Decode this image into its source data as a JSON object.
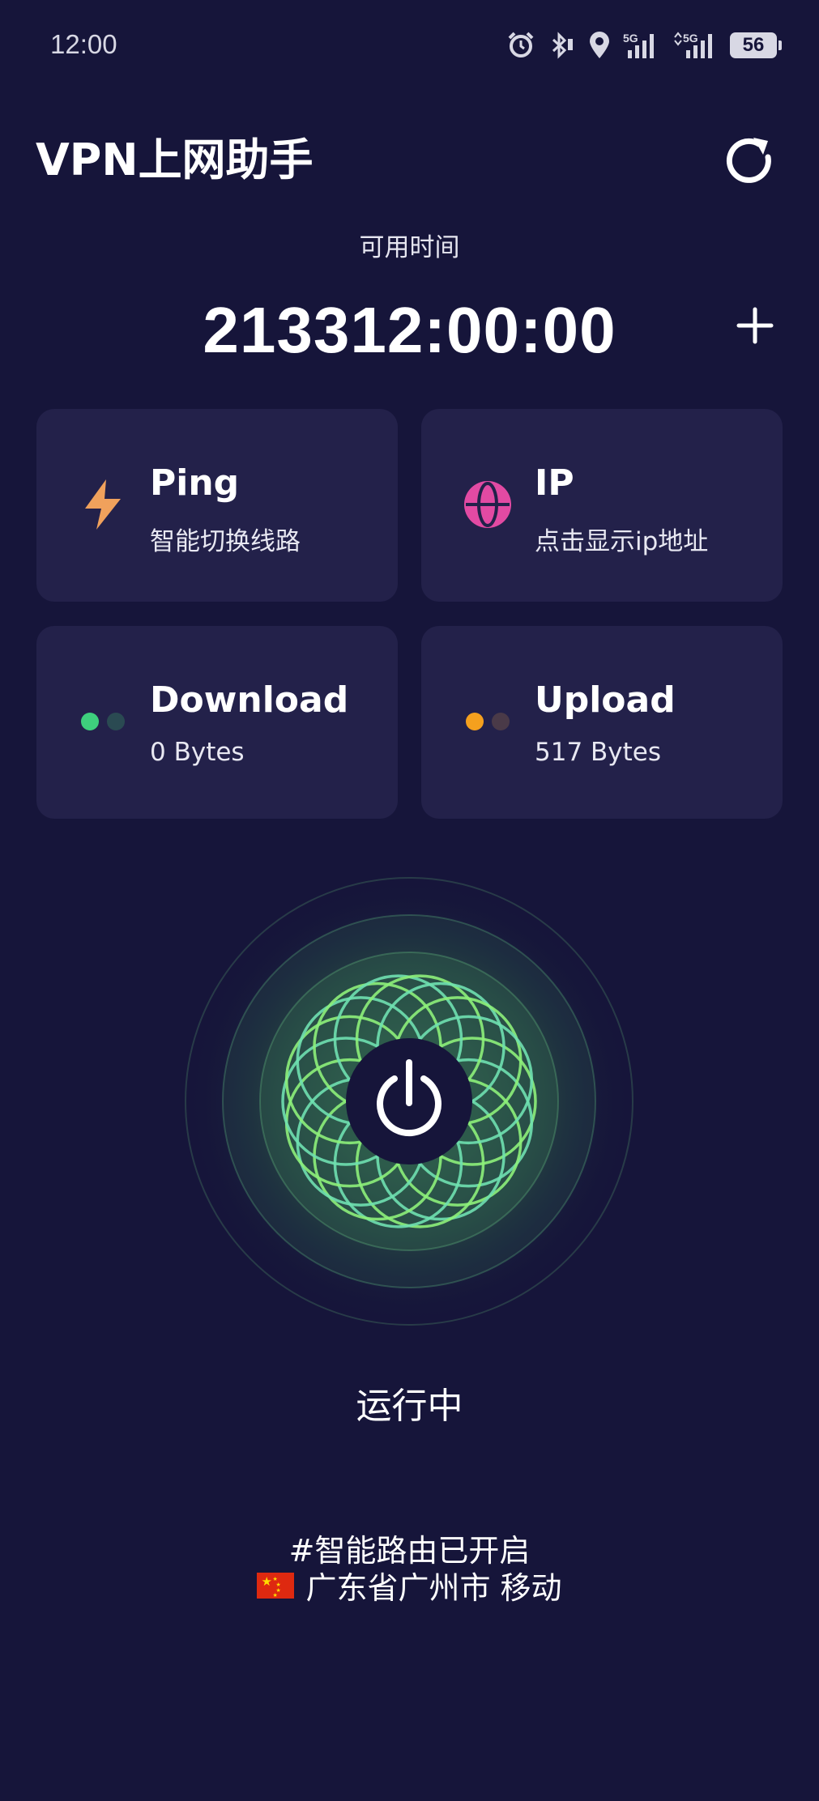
{
  "status_bar": {
    "time": "12:00",
    "network_1": "5G",
    "network_2": "5G",
    "battery": "56",
    "icons": [
      "alarm-icon",
      "bluetooth-icon",
      "location-icon",
      "signal-icon",
      "signal-icon",
      "battery-icon"
    ]
  },
  "header": {
    "title": "VPN上网助手",
    "refresh_icon": "refresh-icon"
  },
  "timer": {
    "label": "可用时间",
    "value": "213312:00:00",
    "add_icon": "plus-icon"
  },
  "cards": {
    "ping": {
      "title": "Ping",
      "subtitle": "智能切换线路",
      "icon": "lightning-icon",
      "icon_color": "#f0a15c"
    },
    "ip": {
      "title": "IP",
      "subtitle": "点击显示ip地址",
      "icon": "globe-icon",
      "icon_color": "#e24aa3"
    },
    "download": {
      "title": "Download",
      "subtitle": "0 Bytes",
      "dot_colors": [
        "#3ecf7d",
        "#2a4a52"
      ]
    },
    "upload": {
      "title": "Upload",
      "subtitle": "517 Bytes",
      "dot_colors": [
        "#f5a01e",
        "#4a3a48"
      ]
    }
  },
  "connection": {
    "status": "运行中",
    "power_icon": "power-icon",
    "ring_color": "#8df07a"
  },
  "footer": {
    "route_text": "#智能路由已开启",
    "location_text": "广东省广州市 移动",
    "flag_icon": "china-flag-icon"
  },
  "colors": {
    "background": "#16153a",
    "card": "#23214a"
  }
}
